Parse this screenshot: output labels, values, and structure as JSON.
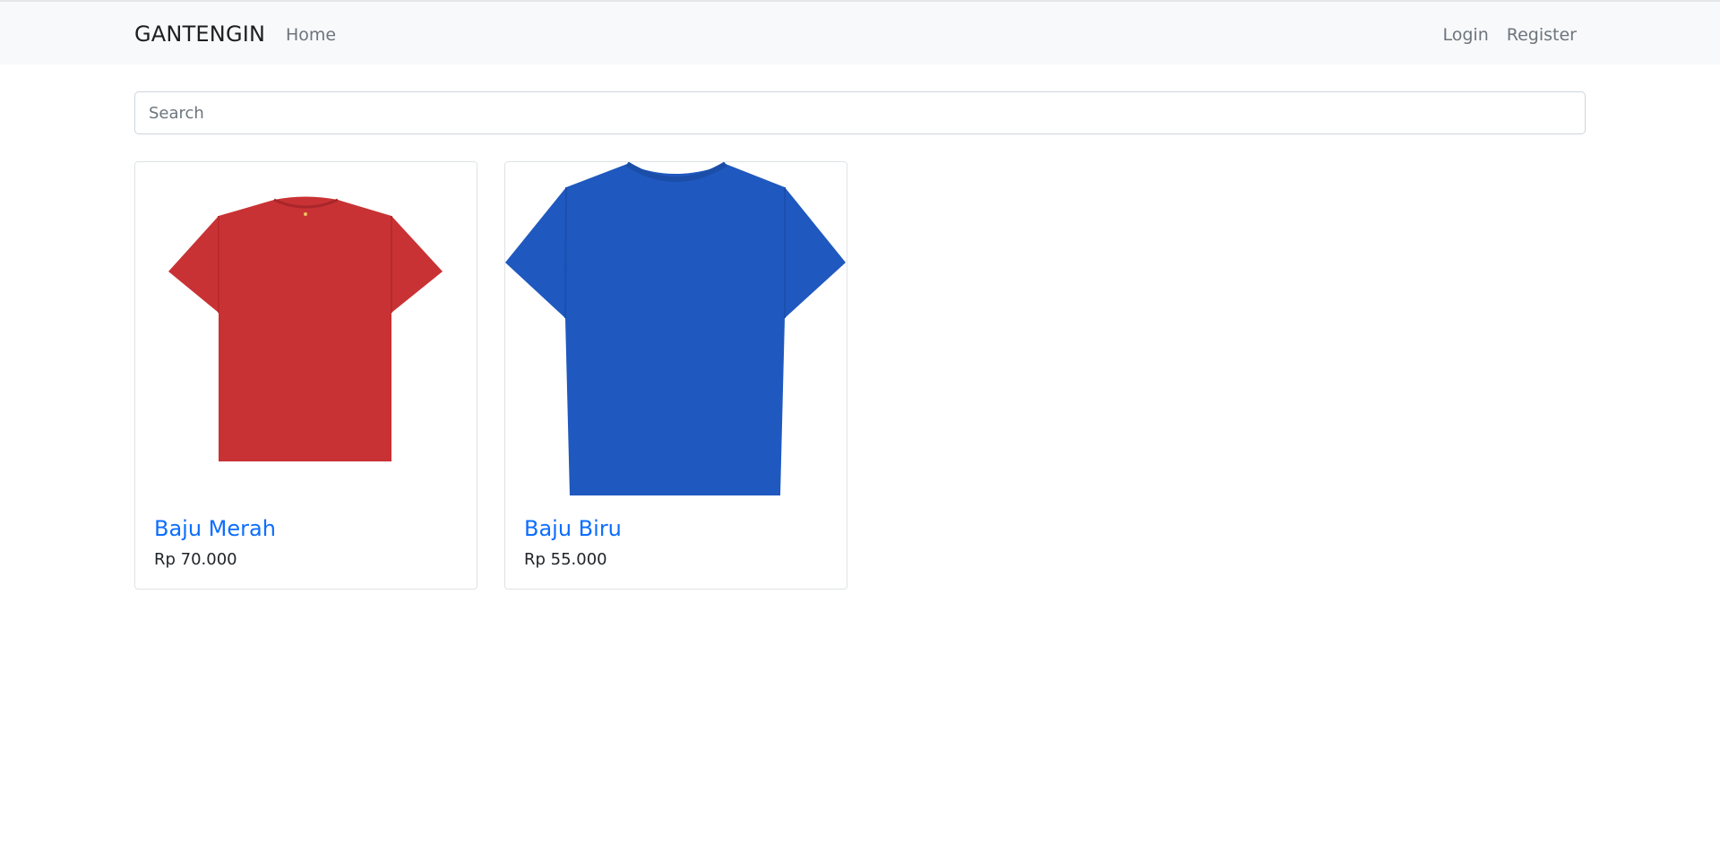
{
  "navbar": {
    "brand": "GANTENGIN",
    "home": "Home",
    "login": "Login",
    "register": "Register"
  },
  "search": {
    "placeholder": "Search",
    "value": ""
  },
  "products": [
    {
      "name": "Baju Merah",
      "price": "Rp 70.000",
      "color": "#c93234",
      "icon": "red-tshirt-image"
    },
    {
      "name": "Baju Biru",
      "price": "Rp 55.000",
      "color": "#1f58bf",
      "icon": "blue-tshirt-image"
    }
  ],
  "colors": {
    "link": "#0d6efd",
    "navbar_bg": "#f8f9fa",
    "nav_text": "#6c757d"
  }
}
